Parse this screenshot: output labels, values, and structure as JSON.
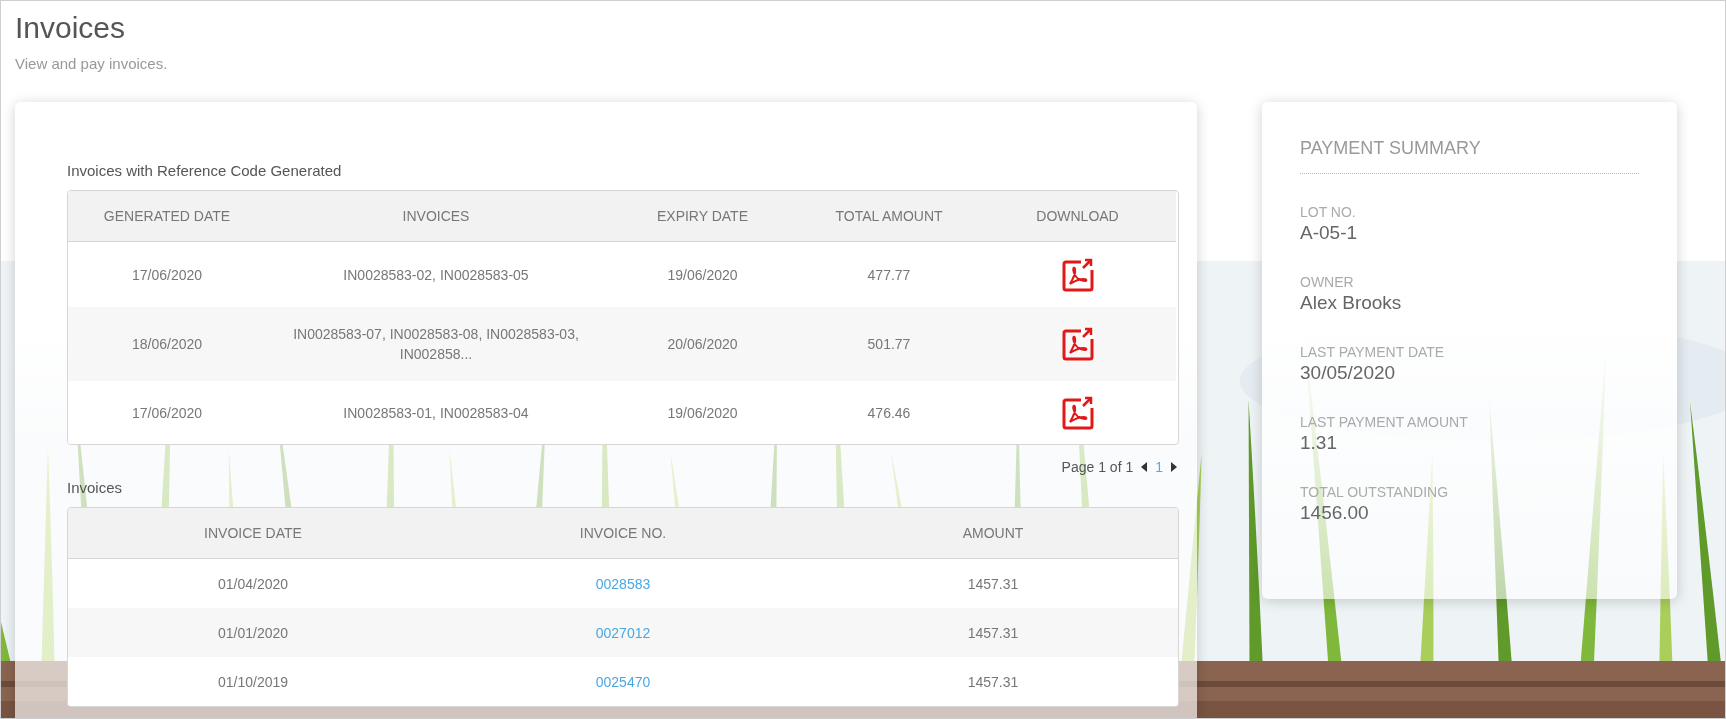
{
  "page": {
    "title": "Invoices",
    "subtitle": "View and pay invoices."
  },
  "reference_invoices": {
    "title": "Invoices with Reference Code Generated",
    "columns": [
      "GENERATED DATE",
      "INVOICES",
      "EXPIRY DATE",
      "TOTAL AMOUNT",
      "DOWNLOAD"
    ],
    "rows": [
      {
        "generated_date": "17/06/2020",
        "invoices": "IN0028583-02, IN0028583-05",
        "expiry_date": "19/06/2020",
        "total_amount": "477.77"
      },
      {
        "generated_date": "18/06/2020",
        "invoices": "IN0028583-07, IN0028583-08, IN0028583-03, IN002858...",
        "expiry_date": "20/06/2020",
        "total_amount": "501.77"
      },
      {
        "generated_date": "17/06/2020",
        "invoices": "IN0028583-01, IN0028583-04",
        "expiry_date": "19/06/2020",
        "total_amount": "476.46"
      }
    ],
    "pagination": {
      "label": "Page 1 of 1",
      "pages": [
        {
          "label": "1",
          "selected": true
        }
      ]
    }
  },
  "invoices": {
    "title": "Invoices",
    "columns": [
      "INVOICE DATE",
      "INVOICE NO.",
      "AMOUNT"
    ],
    "rows": [
      {
        "invoice_date": "01/04/2020",
        "invoice_no": "0028583",
        "amount": "1457.31"
      },
      {
        "invoice_date": "01/01/2020",
        "invoice_no": "0027012",
        "amount": "1457.31"
      },
      {
        "invoice_date": "01/10/2019",
        "invoice_no": "0025470",
        "amount": "1457.31"
      }
    ]
  },
  "payment_summary": {
    "title": "PAYMENT SUMMARY",
    "fields": [
      {
        "label": "LOT NO.",
        "value": "A-05-1"
      },
      {
        "label": "OWNER",
        "value": "Alex Brooks"
      },
      {
        "label": "LAST PAYMENT DATE",
        "value": "30/05/2020"
      },
      {
        "label": "LAST PAYMENT AMOUNT",
        "value": "1.31"
      },
      {
        "label": "TOTAL OUTSTANDING",
        "value": "1456.00"
      }
    ]
  }
}
